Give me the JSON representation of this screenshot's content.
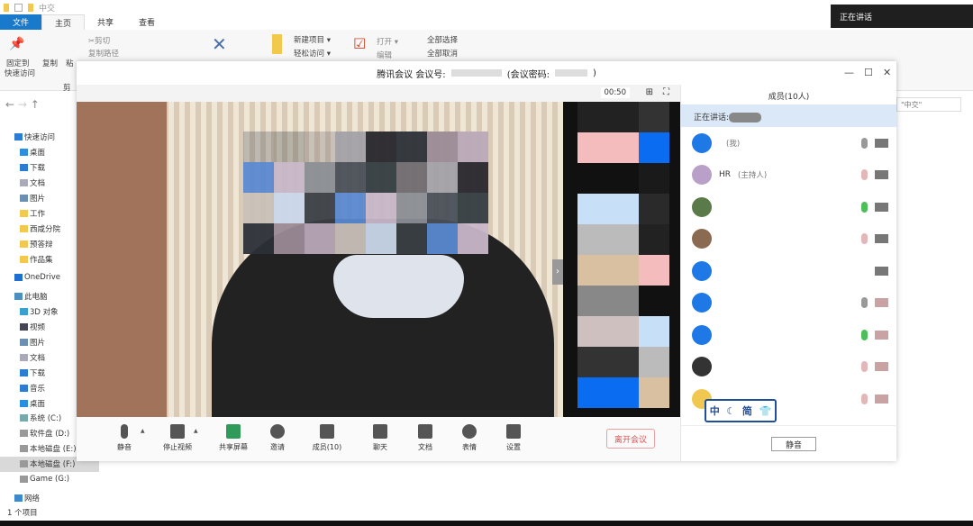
{
  "explorer": {
    "folder_title": "中交",
    "tabs": [
      "文件",
      "主页",
      "共享",
      "查看"
    ],
    "ribbon": {
      "pin": "固定到",
      "pin2": "快速访问",
      "copy": "复制",
      "paste": "粘",
      "cut": "剪切",
      "copy_path": "复制路径",
      "clip_group": "剪",
      "new_item": "新建项目 ▾",
      "easy_access": "轻松访问 ▾",
      "open": "打开 ▾",
      "edit": "编辑",
      "select_all": "全部选择",
      "select_none": "全部取消"
    },
    "search_placeholder": "\"中交\"",
    "tree": [
      {
        "label": "快速访问",
        "top": true,
        "color": "#2b7cd3"
      },
      {
        "label": "桌面",
        "color": "#2b8fe0"
      },
      {
        "label": "下载",
        "color": "#2b7cd3"
      },
      {
        "label": "文档",
        "color": "#aab"
      },
      {
        "label": "图片",
        "color": "#6a8fb0"
      },
      {
        "label": "工作",
        "color": "#f2c94c"
      },
      {
        "label": "西咸分院",
        "color": "#f2c94c"
      },
      {
        "label": "预答辩",
        "color": "#f2c94c"
      },
      {
        "label": "作品集",
        "color": "#f2c94c"
      },
      {
        "label": "OneDrive",
        "top": true,
        "color": "#1f6fd1"
      },
      {
        "label": "此电脑",
        "top": true,
        "color": "#4a90c0"
      },
      {
        "label": "3D 对象",
        "color": "#3aa0d0"
      },
      {
        "label": "视频",
        "color": "#445"
      },
      {
        "label": "图片",
        "color": "#6a8fb0"
      },
      {
        "label": "文档",
        "color": "#aab"
      },
      {
        "label": "下载",
        "color": "#2b7cd3"
      },
      {
        "label": "音乐",
        "color": "#2b7cd3"
      },
      {
        "label": "桌面",
        "color": "#2b8fe0"
      },
      {
        "label": "系统 (C:)",
        "color": "#7aa"
      },
      {
        "label": "软件盘 (D:)",
        "color": "#999"
      },
      {
        "label": "本地磁盘 (E:)",
        "color": "#999"
      },
      {
        "label": "本地磁盘 (F:)",
        "color": "#999",
        "selected": true
      },
      {
        "label": "Game (G:)",
        "color": "#999"
      },
      {
        "label": "网络",
        "top": true,
        "color": "#3a8ad0"
      }
    ],
    "status": "1 个项目"
  },
  "toast": "正在讲话",
  "meeting": {
    "title": "腾讯会议 会议号:",
    "password_label": "(会议密码:",
    "password_end": ")",
    "timer": "00:50",
    "controls": [
      {
        "label": "静音",
        "icon": "microphone-icon"
      },
      {
        "label": "停止视频",
        "icon": "camera-icon"
      },
      {
        "label": "共享屏幕",
        "icon": "share-screen-icon"
      },
      {
        "label": "邀请",
        "icon": "invite-icon"
      },
      {
        "label": "成员(10)",
        "icon": "members-icon"
      },
      {
        "label": "聊天",
        "icon": "chat-icon"
      },
      {
        "label": "文档",
        "icon": "document-icon"
      },
      {
        "label": "表情",
        "icon": "emoji-icon"
      },
      {
        "label": "设置",
        "icon": "settings-icon"
      }
    ],
    "leave": "离开会议",
    "panel": {
      "title": "成员(10人)",
      "speaking": "正在讲话:",
      "members": [
        {
          "name": "",
          "role": "(我)",
          "mic": "on",
          "cam": "on",
          "avatar": "#1e78e6"
        },
        {
          "name": "HR",
          "role": "(主持人)",
          "mic": "off",
          "cam": "on",
          "avatar": "#b9a0c8"
        },
        {
          "name": "",
          "role": "",
          "mic": "green",
          "cam": "on",
          "avatar": "#5b7a4a"
        },
        {
          "name": "",
          "role": "",
          "mic": "off",
          "cam": "on",
          "avatar": "#8a6a50"
        },
        {
          "name": "",
          "role": "",
          "mic": "none",
          "cam": "on",
          "avatar": "#1e78e6"
        },
        {
          "name": "",
          "role": "",
          "mic": "on",
          "cam": "off",
          "avatar": "#1e78e6"
        },
        {
          "name": "",
          "role": "",
          "mic": "green",
          "cam": "off",
          "avatar": "#1e78e6"
        },
        {
          "name": "",
          "role": "",
          "mic": "off",
          "cam": "off",
          "avatar": "#333"
        },
        {
          "name": "",
          "role": "",
          "mic": "off",
          "cam": "off",
          "avatar": "#f0c850"
        }
      ],
      "mute_all": "静音"
    }
  },
  "ime": [
    "中",
    "☾",
    "简",
    "👕"
  ]
}
